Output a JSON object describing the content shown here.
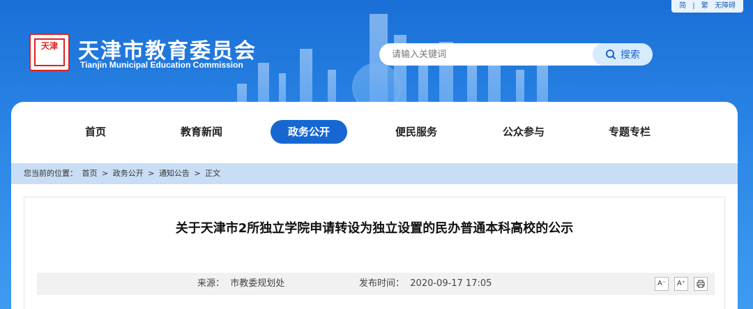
{
  "toplinks": {
    "simplified": "简",
    "sep": "|",
    "traditional": "繁",
    "accessibility": "无障碍"
  },
  "site": {
    "name": "天津市教育委员会",
    "subtitle": "Tianjin Municipal Education Commission",
    "logo_text": "天津"
  },
  "search": {
    "placeholder": "请输入关键词",
    "button": "搜索"
  },
  "nav": [
    {
      "label": "首页"
    },
    {
      "label": "教育新闻"
    },
    {
      "label": "政务公开"
    },
    {
      "label": "便民服务"
    },
    {
      "label": "公众参与"
    },
    {
      "label": "专题专栏"
    }
  ],
  "breadcrumb": {
    "prefix": "您当前的位置：",
    "items": [
      "首页",
      "政务公开",
      "通知公告",
      "正文"
    ],
    "sep": ">"
  },
  "article": {
    "title": "关于天津市2所独立学院申请转设为独立设置的民办普通本科高校的公示",
    "source_label": "来源：",
    "source": "市教委规划处",
    "time_label": "发布时间：",
    "time": "2020-09-17 17:05",
    "font_smaller": "A⁻",
    "font_larger": "A⁺"
  }
}
